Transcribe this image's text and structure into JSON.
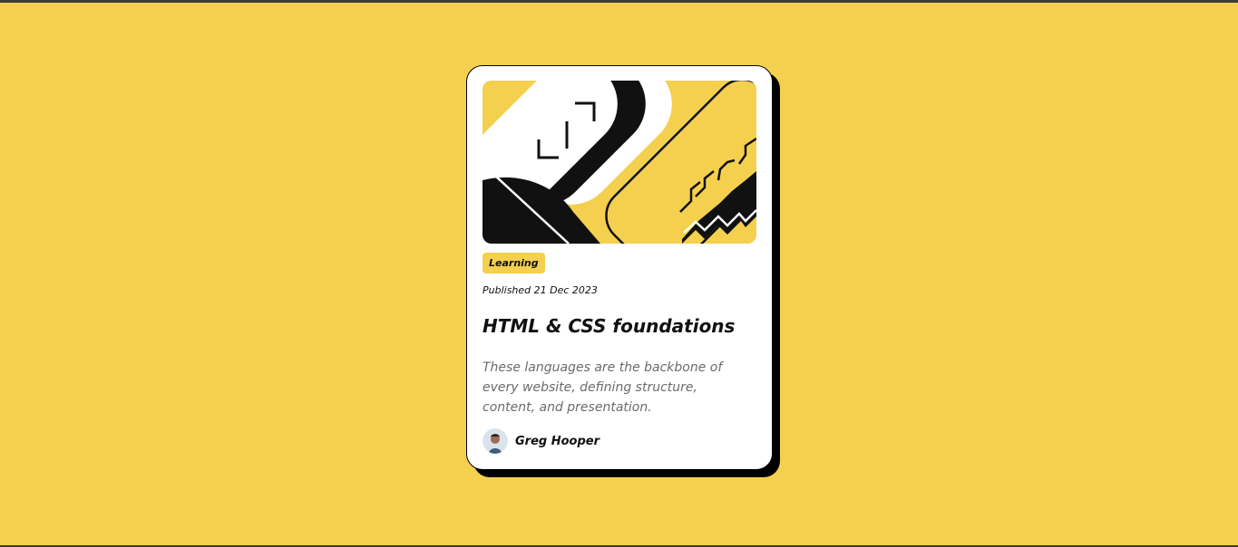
{
  "card": {
    "tag": "Learning",
    "published": "Published 21 Dec 2023",
    "title": "HTML & CSS foundations",
    "description": "These languages are the backbone of every website, defining structure, content, and presentation.",
    "author": {
      "name": "Greg Hooper",
      "avatar_icon": "person-avatar"
    },
    "illustration_icon": "abstract-code-illustration"
  },
  "colors": {
    "background": "#F4D04E",
    "card": "#FFFFFF",
    "shadow": "#000000",
    "text": "#111111",
    "muted_text": "#6B6B6B",
    "tag": "#F4D04E"
  }
}
